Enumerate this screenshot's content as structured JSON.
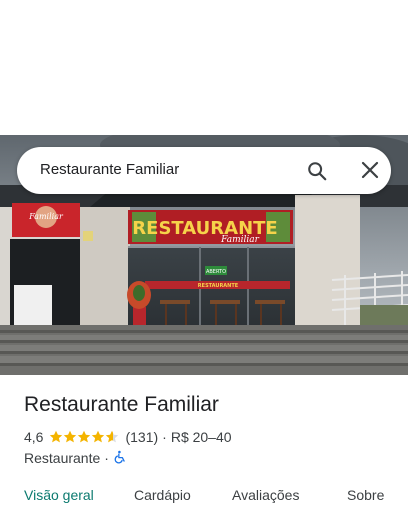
{
  "search": {
    "query": "Restaurante Familiar",
    "search_icon": "search-icon",
    "close_icon": "close-icon"
  },
  "photo": {
    "sign_main": "RESTAURANTE",
    "sign_sub": "Familiar",
    "side_sign": "Familiar",
    "open_sign": "ABERTO",
    "window_banner": "RESTAURANTE"
  },
  "place": {
    "name": "Restaurante Familiar",
    "rating": "4,6",
    "stars": 4.6,
    "review_count": "(131)",
    "separator": "·",
    "price_range": "R$ 20–40",
    "category": "Restaurante",
    "accessibility_icon": "wheelchair-icon"
  },
  "tabs": [
    {
      "label": "Visão geral",
      "active": true
    },
    {
      "label": "Cardápio",
      "active": false
    },
    {
      "label": "Avaliações",
      "active": false
    },
    {
      "label": "Sobre",
      "active": false
    }
  ],
  "colors": {
    "accent": "#0b7a6f",
    "star": "#f4b400",
    "accessibility": "#1a73e8"
  }
}
